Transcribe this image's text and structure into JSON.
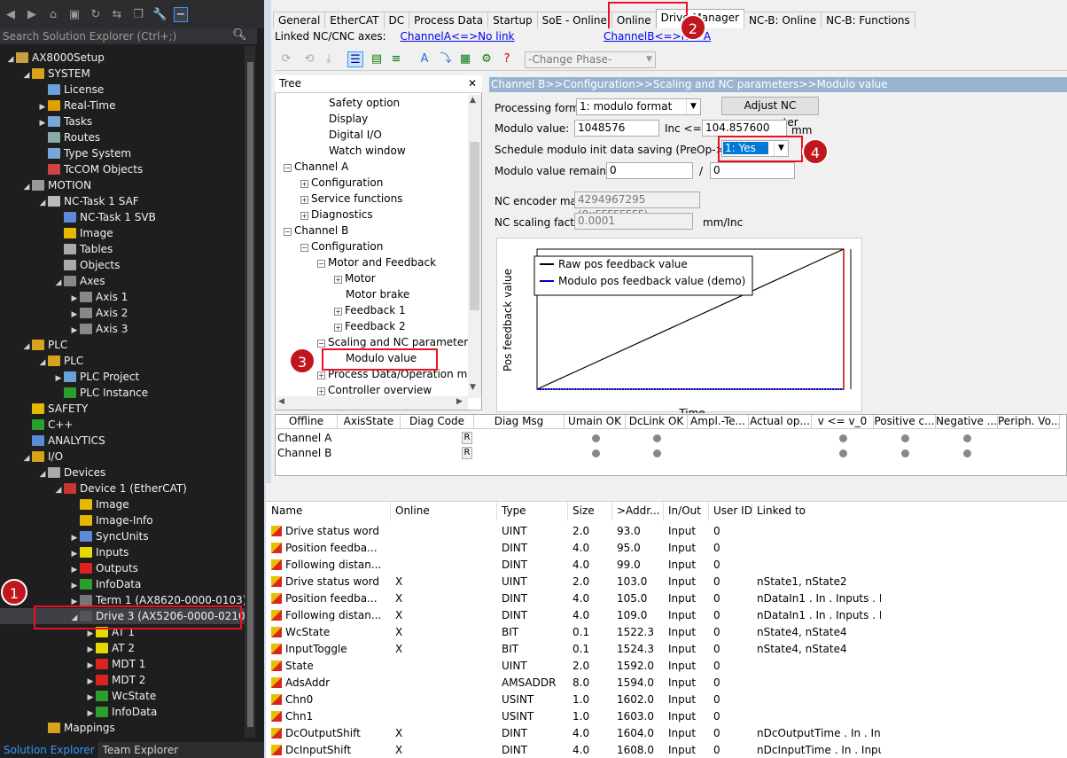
{
  "solution_explorer": {
    "search_placeholder": "Search Solution Explorer (Ctrl+;)",
    "tree": [
      {
        "label": "AX8000Setup",
        "level": 0,
        "arrow": "◢",
        "icon": "project-icon"
      },
      {
        "label": "SYSTEM",
        "level": 1,
        "arrow": "◢",
        "icon": "system-icon"
      },
      {
        "label": "License",
        "level": 2,
        "arrow": "",
        "icon": "license-icon"
      },
      {
        "label": "Real-Time",
        "level": 2,
        "arrow": "▶",
        "icon": "realtime-icon"
      },
      {
        "label": "Tasks",
        "level": 2,
        "arrow": "▶",
        "icon": "tasks-icon"
      },
      {
        "label": "Routes",
        "level": 2,
        "arrow": "",
        "icon": "routes-icon"
      },
      {
        "label": "Type System",
        "level": 2,
        "arrow": "",
        "icon": "typesystem-icon"
      },
      {
        "label": "TcCOM Objects",
        "level": 2,
        "arrow": "",
        "icon": "tccom-icon"
      },
      {
        "label": "MOTION",
        "level": 1,
        "arrow": "◢",
        "icon": "motion-icon"
      },
      {
        "label": "NC-Task 1 SAF",
        "level": 2,
        "arrow": "◢",
        "icon": "nctask-icon"
      },
      {
        "label": "NC-Task 1 SVB",
        "level": 3,
        "arrow": "",
        "icon": "nctask-svb-icon"
      },
      {
        "label": "Image",
        "level": 3,
        "arrow": "",
        "icon": "image-icon"
      },
      {
        "label": "Tables",
        "level": 3,
        "arrow": "",
        "icon": "tables-icon"
      },
      {
        "label": "Objects",
        "level": 3,
        "arrow": "",
        "icon": "objects-icon"
      },
      {
        "label": "Axes",
        "level": 3,
        "arrow": "◢",
        "icon": "axes-icon"
      },
      {
        "label": "Axis 1",
        "level": 4,
        "arrow": "▶",
        "icon": "axis-icon"
      },
      {
        "label": "Axis 2",
        "level": 4,
        "arrow": "▶",
        "icon": "axis-icon"
      },
      {
        "label": "Axis 3",
        "level": 4,
        "arrow": "▶",
        "icon": "axis-icon"
      },
      {
        "label": "PLC",
        "level": 1,
        "arrow": "◢",
        "icon": "plc-icon"
      },
      {
        "label": "PLC",
        "level": 2,
        "arrow": "◢",
        "icon": "plc-sub-icon"
      },
      {
        "label": "PLC Project",
        "level": 3,
        "arrow": "▶",
        "icon": "plc-project-icon"
      },
      {
        "label": "PLC Instance",
        "level": 3,
        "arrow": "",
        "icon": "plc-instance-icon"
      },
      {
        "label": "SAFETY",
        "level": 1,
        "arrow": "",
        "icon": "safety-icon"
      },
      {
        "label": "C++",
        "level": 1,
        "arrow": "",
        "icon": "cpp-icon"
      },
      {
        "label": "ANALYTICS",
        "level": 1,
        "arrow": "",
        "icon": "analytics-icon"
      },
      {
        "label": "I/O",
        "level": 1,
        "arrow": "◢",
        "icon": "io-icon"
      },
      {
        "label": "Devices",
        "level": 2,
        "arrow": "◢",
        "icon": "devices-icon"
      },
      {
        "label": "Device 1 (EtherCAT)",
        "level": 3,
        "arrow": "◢",
        "icon": "ethercat-icon"
      },
      {
        "label": "Image",
        "level": 4,
        "arrow": "",
        "icon": "image-icon"
      },
      {
        "label": "Image-Info",
        "level": 4,
        "arrow": "",
        "icon": "image-info-icon"
      },
      {
        "label": "SyncUnits",
        "level": 4,
        "arrow": "▶",
        "icon": "syncunits-icon"
      },
      {
        "label": "Inputs",
        "level": 4,
        "arrow": "▶",
        "icon": "inputs-icon"
      },
      {
        "label": "Outputs",
        "level": 4,
        "arrow": "▶",
        "icon": "outputs-icon"
      },
      {
        "label": "InfoData",
        "level": 4,
        "arrow": "▶",
        "icon": "infodata-icon"
      },
      {
        "label": "Term 1 (AX8620-0000-0103)",
        "level": 4,
        "arrow": "▶",
        "icon": "term-icon"
      },
      {
        "label": "Drive 3 (AX5206-0000-0210)",
        "level": 4,
        "arrow": "◢",
        "icon": "drive-icon",
        "selected": true
      },
      {
        "label": "AT 1",
        "level": 5,
        "arrow": "▶",
        "icon": "at-icon"
      },
      {
        "label": "AT 2",
        "level": 5,
        "arrow": "▶",
        "icon": "at-icon"
      },
      {
        "label": "MDT 1",
        "level": 5,
        "arrow": "▶",
        "icon": "mdt-icon"
      },
      {
        "label": "MDT 2",
        "level": 5,
        "arrow": "▶",
        "icon": "mdt-icon"
      },
      {
        "label": "WcState",
        "level": 5,
        "arrow": "▶",
        "icon": "wcstate-icon"
      },
      {
        "label": "InfoData",
        "level": 5,
        "arrow": "▶",
        "icon": "infodata-green-icon"
      },
      {
        "label": "Mappings",
        "level": 2,
        "arrow": "",
        "icon": "mappings-icon"
      }
    ],
    "bottom_tabs": [
      "Solution Explorer",
      "Team Explorer"
    ]
  },
  "badges": [
    "1",
    "2",
    "3",
    "4"
  ],
  "tabs": [
    "General",
    "EtherCAT",
    "DC",
    "Process Data",
    "Startup",
    "SoE - Online",
    "Online",
    "Drive Manager",
    "NC-B: Online",
    "NC-B: Functions"
  ],
  "active_tab": "Drive Manager",
  "linked": {
    "label": "Linked NC/CNC axes:",
    "a": "ChannelA<=>No link",
    "b": "ChannelB<=>NC: A"
  },
  "phase_select": "-Change Phase-",
  "tree_panel": {
    "title": "Tree",
    "close": "✕",
    "items": [
      {
        "label": "Safety option",
        "level": 2,
        "pm": ""
      },
      {
        "label": "Display",
        "level": 2,
        "pm": ""
      },
      {
        "label": "Digital I/O",
        "level": 2,
        "pm": ""
      },
      {
        "label": "Watch window",
        "level": 2,
        "pm": ""
      },
      {
        "label": "Channel A",
        "level": 0,
        "pm": "−"
      },
      {
        "label": "Configuration",
        "level": 1,
        "pm": "+"
      },
      {
        "label": "Service functions",
        "level": 1,
        "pm": "+"
      },
      {
        "label": "Diagnostics",
        "level": 1,
        "pm": "+"
      },
      {
        "label": "Channel B",
        "level": 0,
        "pm": "−"
      },
      {
        "label": "Configuration",
        "level": 1,
        "pm": "−"
      },
      {
        "label": "Motor and Feedback",
        "level": 2,
        "pm": "−"
      },
      {
        "label": "Motor",
        "level": 3,
        "pm": "+"
      },
      {
        "label": "Motor brake",
        "level": 3,
        "pm": ""
      },
      {
        "label": "Feedback 1",
        "level": 3,
        "pm": "+"
      },
      {
        "label": "Feedback 2",
        "level": 3,
        "pm": "+"
      },
      {
        "label": "Scaling and NC parameters",
        "level": 2,
        "pm": "−"
      },
      {
        "label": "Modulo value",
        "level": 3,
        "pm": ""
      },
      {
        "label": "Process Data/Operation mod",
        "level": 2,
        "pm": "+"
      },
      {
        "label": "Controller overview",
        "level": 2,
        "pm": "+"
      }
    ]
  },
  "detail": {
    "breadcrumb": "Channel B>>Configuration>>Scaling and NC parameters>>Modulo value",
    "processing_format_label": "Processing format:",
    "processing_format_value": "1: modulo format",
    "adjust_button": "Adjust NC parameter",
    "modulo_value_label": "Modulo value:",
    "modulo_value": "1048576",
    "inc_label": "Inc <=>",
    "modulo_mm": "104.857600",
    "mm_unit": "mm",
    "schedule_label": "Schedule modulo init data saving (PreOp->SafeOp):",
    "schedule_value": "1: Yes",
    "remainder_label": "Modulo value remainder:",
    "remainder_a": "0",
    "slash": "/",
    "remainder_b": "0",
    "encoder_mask_label": "NC encoder mask:",
    "encoder_mask": "4294967295 (0xFFFFFFFF)",
    "scaling_factor_label": "NC scaling factor:",
    "scaling_factor": "0.0001",
    "scaling_unit": "mm/Inc"
  },
  "chart_data": {
    "type": "line",
    "ylabel": "Pos feedback value",
    "xlabel": "Time",
    "series": [
      {
        "name": "Raw pos feedback value",
        "color": "#000000",
        "x": [
          0,
          1
        ],
        "y": [
          0,
          1
        ]
      },
      {
        "name": "Modulo pos feedback value (demo)",
        "color": "#0000cc",
        "x": [
          0,
          1
        ],
        "y": [
          0,
          0
        ]
      }
    ],
    "legend_position": "top-left",
    "grid": false
  },
  "diag": {
    "headers": [
      "Offline",
      "AxisState",
      "Diag Code",
      "Diag Msg",
      "Umain OK",
      "DcLink OK",
      "Ampl.-Te...",
      "Actual op...",
      "v <= v_0",
      "Positive c...",
      "Negative ...",
      "Periph. Vo..."
    ],
    "rows": [
      {
        "name": "Channel A",
        "r": "R"
      },
      {
        "name": "Channel B",
        "r": "R"
      }
    ]
  },
  "grid": {
    "headers": [
      "Name",
      "Online",
      "Type",
      "Size",
      ">Addr...",
      "In/Out",
      "User ID",
      "Linked to"
    ],
    "rows": [
      {
        "name": "Drive status word",
        "online": "",
        "type": "UINT",
        "size": "2.0",
        "addr": "93.0",
        "inout": "Input",
        "user": "0",
        "linked": ""
      },
      {
        "name": "Position feedba...",
        "online": "",
        "type": "DINT",
        "size": "4.0",
        "addr": "95.0",
        "inout": "Input",
        "user": "0",
        "linked": ""
      },
      {
        "name": "Following distan...",
        "online": "",
        "type": "DINT",
        "size": "4.0",
        "addr": "99.0",
        "inout": "Input",
        "user": "0",
        "linked": ""
      },
      {
        "name": "Drive status word",
        "online": "X",
        "type": "UINT",
        "size": "2.0",
        "addr": "103.0",
        "inout": "Input",
        "user": "0",
        "linked": "nState1, nState2"
      },
      {
        "name": "Position feedba...",
        "online": "X",
        "type": "DINT",
        "size": "4.0",
        "addr": "105.0",
        "inout": "Input",
        "user": "0",
        "linked": "nDataIn1 . In . Inputs . E..."
      },
      {
        "name": "Following distan...",
        "online": "X",
        "type": "DINT",
        "size": "4.0",
        "addr": "109.0",
        "inout": "Input",
        "user": "0",
        "linked": "nDataIn1 . In . Inputs . Dr..."
      },
      {
        "name": "WcState",
        "online": "X",
        "type": "BIT",
        "size": "0.1",
        "addr": "1522.3",
        "inout": "Input",
        "user": "0",
        "linked": "nState4, nState4"
      },
      {
        "name": "InputToggle",
        "online": "X",
        "type": "BIT",
        "size": "0.1",
        "addr": "1524.3",
        "inout": "Input",
        "user": "0",
        "linked": "nState4, nState4"
      },
      {
        "name": "State",
        "online": "",
        "type": "UINT",
        "size": "2.0",
        "addr": "1592.0",
        "inout": "Input",
        "user": "0",
        "linked": ""
      },
      {
        "name": "AdsAddr",
        "online": "",
        "type": "AMSADDR",
        "size": "8.0",
        "addr": "1594.0",
        "inout": "Input",
        "user": "0",
        "linked": ""
      },
      {
        "name": "Chn0",
        "online": "",
        "type": "USINT",
        "size": "1.0",
        "addr": "1602.0",
        "inout": "Input",
        "user": "0",
        "linked": ""
      },
      {
        "name": "Chn1",
        "online": "",
        "type": "USINT",
        "size": "1.0",
        "addr": "1603.0",
        "inout": "Input",
        "user": "0",
        "linked": ""
      },
      {
        "name": "DcOutputShift",
        "online": "X",
        "type": "DINT",
        "size": "4.0",
        "addr": "1604.0",
        "inout": "Input",
        "user": "0",
        "linked": "nDcOutputTime . In . In..."
      },
      {
        "name": "DcInputShift",
        "online": "X",
        "type": "DINT",
        "size": "4.0",
        "addr": "1608.0",
        "inout": "Input",
        "user": "0",
        "linked": "nDcInputTime . In . Inpu..."
      }
    ]
  }
}
